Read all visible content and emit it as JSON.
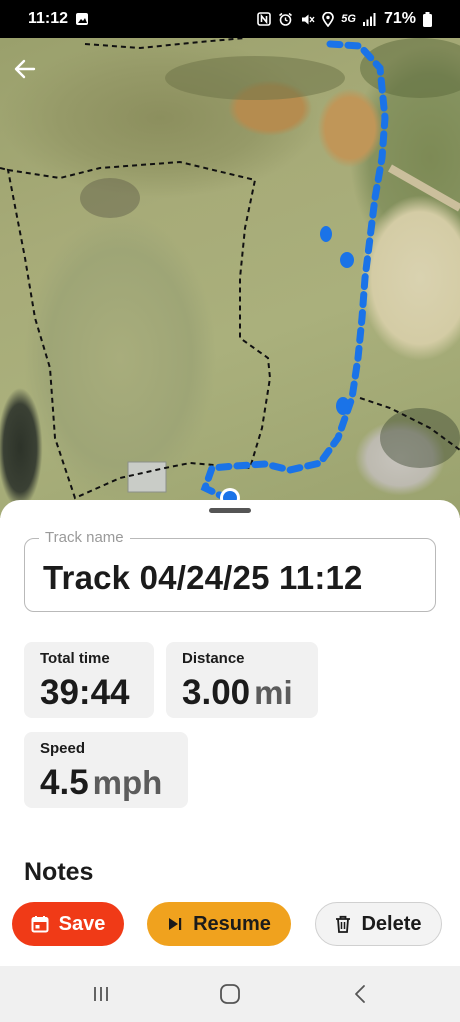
{
  "status_bar": {
    "time": "11:12",
    "network": "5G",
    "battery": "71%",
    "icons": [
      "image-icon",
      "nfc-icon",
      "alarm-icon",
      "mute-icon",
      "location-icon",
      "signal-icon",
      "battery-icon"
    ]
  },
  "map": {
    "back_icon": "arrow-left-icon",
    "track_color": "#1a73e8"
  },
  "track": {
    "name_label": "Track name",
    "name_value": "Track 04/24/25 11:12"
  },
  "stats": {
    "total_time": {
      "label": "Total time",
      "value": "39:44"
    },
    "distance": {
      "label": "Distance",
      "value": "3.00",
      "unit": "mi"
    },
    "speed": {
      "label": "Speed",
      "value": "4.5",
      "unit": "mph"
    }
  },
  "notes": {
    "heading": "Notes"
  },
  "actions": {
    "save": {
      "label": "Save",
      "icon": "calendar-icon",
      "color": "#f03a17"
    },
    "resume": {
      "label": "Resume",
      "icon": "play-next-icon",
      "color": "#f0a21e"
    },
    "delete": {
      "label": "Delete",
      "icon": "trash-icon"
    }
  },
  "nav": {
    "icons": [
      "recent-apps-icon",
      "home-icon",
      "back-icon"
    ]
  }
}
